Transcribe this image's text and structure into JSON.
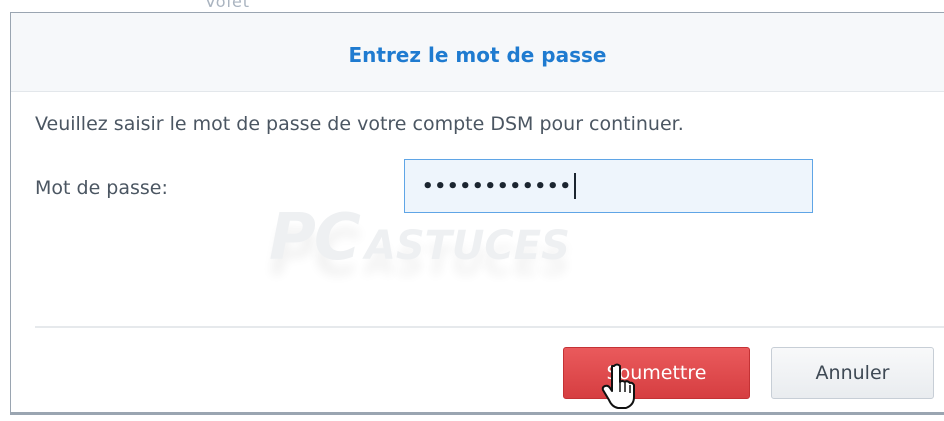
{
  "background_fragment": "Volet",
  "dialog": {
    "title": "Entrez le mot de passe",
    "message": "Veuillez saisir le mot de passe de votre compte DSM pour continuer.",
    "password_label": "Mot de passe:",
    "password_value": "••••••••••••",
    "submit_label": "Soumettre",
    "cancel_label": "Annuler"
  },
  "watermark": {
    "big": "PC",
    "small": "ASTUCES"
  },
  "colors": {
    "title": "#1f7bd0",
    "submit": "#de4a4d",
    "input_focus": "#5fa5e6"
  },
  "icons": {
    "cursor": "hand-pointer-icon",
    "watermark_sun": "lightbulb-sun-icon"
  }
}
